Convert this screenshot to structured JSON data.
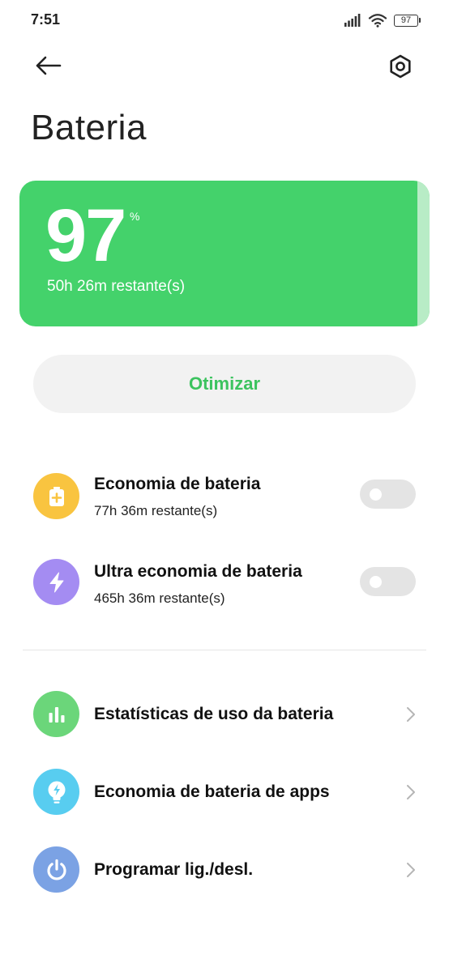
{
  "status_bar": {
    "time": "7:51",
    "battery": "97",
    "icons": [
      "signal-icon",
      "wifi-icon",
      "battery-icon"
    ]
  },
  "header": {
    "back_icon": "arrow-left-icon",
    "settings_icon": "hexagon-gear-icon"
  },
  "page": {
    "title": "Bateria"
  },
  "battery_card": {
    "level": "97",
    "unit": "%",
    "remaining": "50h 26m restante(s)",
    "level_fraction": 0.97,
    "color": "#44d26b"
  },
  "optimize": {
    "label": "Otimizar",
    "color": "#3cc35f"
  },
  "modes": [
    {
      "title": "Economia de bateria",
      "subtitle": "77h 36m restante(s)",
      "icon": "battery-plus-icon",
      "icon_color": "#f9c440",
      "enabled": false
    },
    {
      "title": "Ultra economia de bateria",
      "subtitle": "465h 36m restante(s)",
      "icon": "lightning-icon",
      "icon_color": "#a48cf2",
      "enabled": false
    }
  ],
  "links": [
    {
      "title": "Estatísticas de uso da bateria",
      "icon": "bar-chart-icon",
      "icon_color": "#6bd67a"
    },
    {
      "title": "Economia de bateria de apps",
      "icon": "lightbulb-bolt-icon",
      "icon_color": "#58cdf0"
    },
    {
      "title": "Programar lig./desl.",
      "icon": "power-icon",
      "icon_color": "#7ba2e4"
    }
  ]
}
